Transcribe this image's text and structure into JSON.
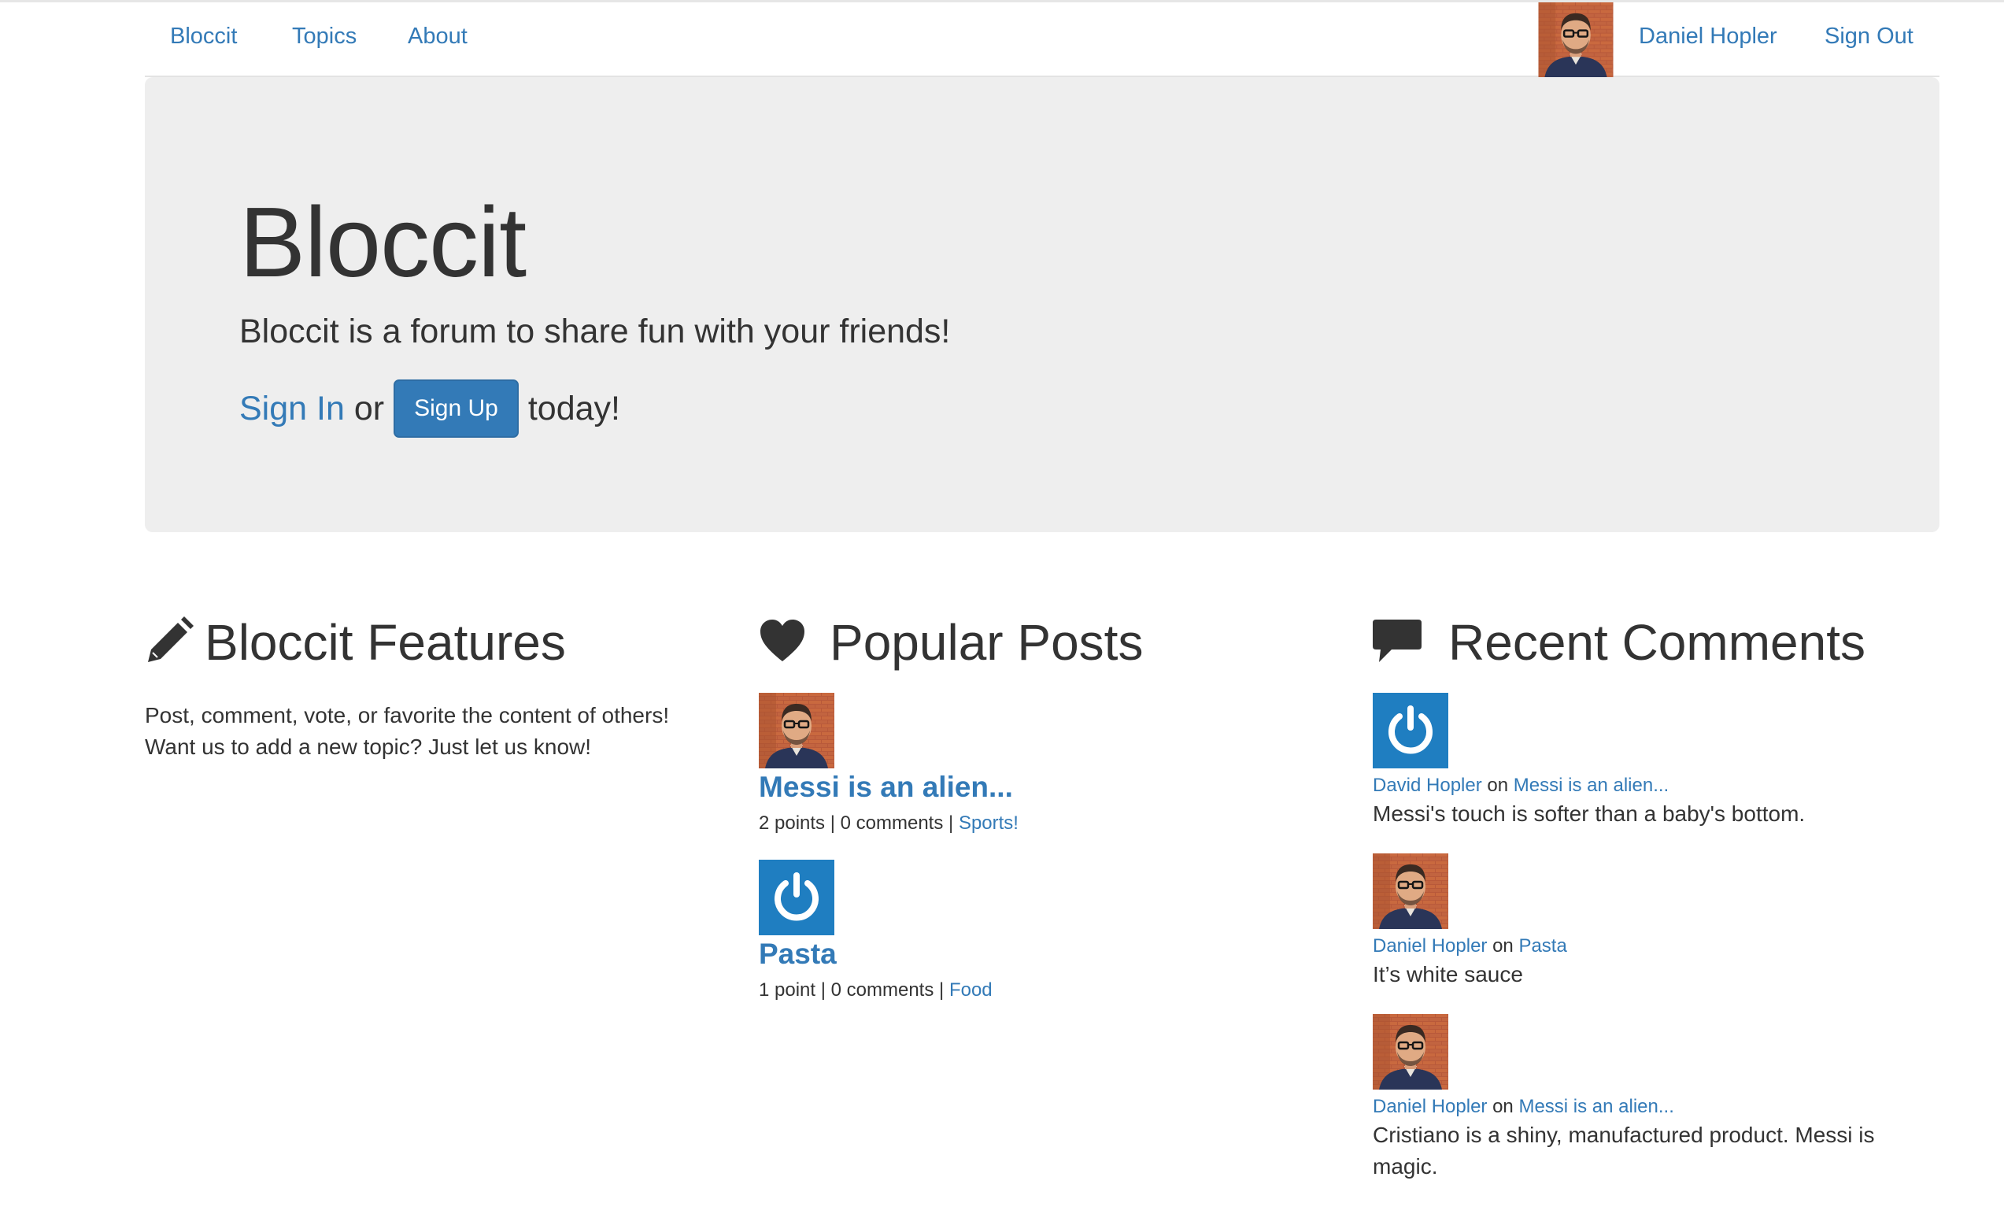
{
  "nav": {
    "brand": "Bloccit",
    "topics": "Topics",
    "about": "About",
    "user_name": "Daniel Hopler",
    "sign_out": "Sign Out",
    "avatar_icon": "user-avatar-photo"
  },
  "jumbotron": {
    "title": "Bloccit",
    "lead": "Bloccit is a forum to share fun with your friends!",
    "sign_in": "Sign In",
    "or": "or",
    "sign_up": "Sign Up",
    "today": "today!"
  },
  "features": {
    "icon": "pencil-icon",
    "title": "Bloccit Features",
    "lines": [
      "Post, comment, vote, or favorite the content of others!",
      "Want us to add a new topic? Just let us know!"
    ]
  },
  "popular": {
    "icon": "heart-icon",
    "title": "Popular Posts",
    "posts": [
      {
        "avatar": "photo",
        "title": "Messi is an alien...",
        "points": "2 points",
        "comments": "0 comments",
        "topic": "Sports!"
      },
      {
        "avatar": "power-icon",
        "title": "Pasta",
        "points": "1 point",
        "comments": "0 comments",
        "topic": "Food"
      }
    ]
  },
  "recent": {
    "icon": "speech-bubble-icon",
    "title": "Recent Comments",
    "on_word": "on",
    "comments": [
      {
        "avatar": "power-icon",
        "user": "David Hopler",
        "post": "Messi is an alien...",
        "body": "Messi's touch is softer than a baby's bottom."
      },
      {
        "avatar": "photo",
        "user": "Daniel Hopler",
        "post": "Pasta",
        "body": "It’s white sauce"
      },
      {
        "avatar": "photo",
        "user": "Daniel Hopler",
        "post": "Messi is an alien...",
        "body": "Cristiano is a shiny, manufactured product. Messi is magic."
      }
    ]
  },
  "colors": {
    "link": "#337ab7",
    "jumbotron_bg": "#eeeeee",
    "button_bg": "#337ab7",
    "power_icon_bg": "#1f7ec1"
  }
}
